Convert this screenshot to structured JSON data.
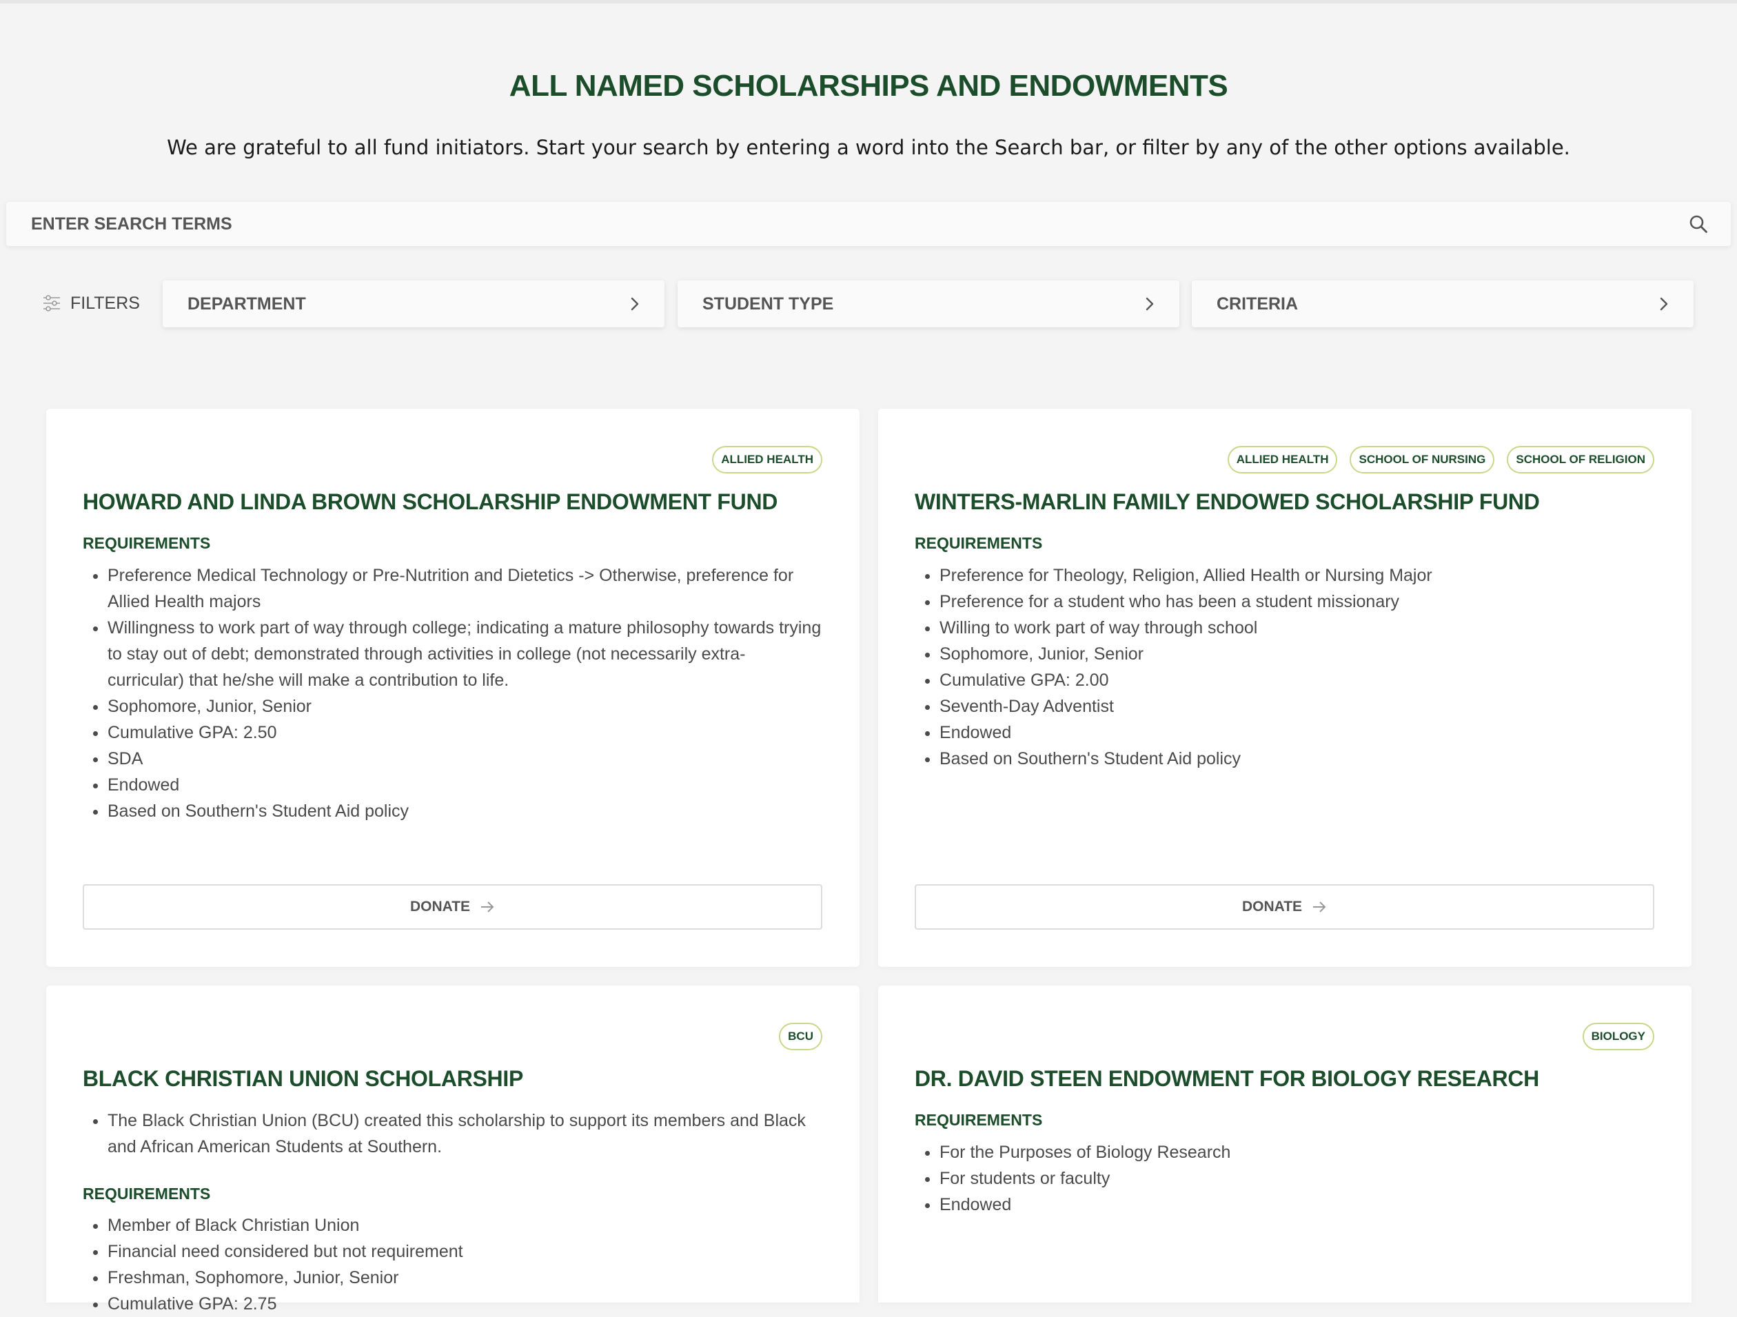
{
  "header": {
    "title": "ALL NAMED SCHOLARSHIPS AND ENDOWMENTS",
    "intro": "We are grateful to all fund initiators. Start your search by entering a word into the Search bar, or filter by any of the other options available."
  },
  "search": {
    "placeholder": "ENTER SEARCH TERMS",
    "value": ""
  },
  "filters": {
    "label": "FILTERS",
    "dropdowns": [
      {
        "label": "DEPARTMENT"
      },
      {
        "label": "STUDENT TYPE"
      },
      {
        "label": "CRITERIA"
      }
    ]
  },
  "cards": [
    {
      "tags": [
        "ALLIED HEALTH"
      ],
      "title": "HOWARD AND LINDA BROWN SCHOLARSHIP ENDOWMENT FUND",
      "requirements_label": "REQUIREMENTS",
      "requirements": [
        "Preference Medical Technology or Pre-Nutrition and Dietetics -> Otherwise, preference for Allied Health majors",
        "Willingness to work part of way through college; indicating a mature philosophy towards trying to stay out of debt; demonstrated through activities in college (not necessarily extra-curricular) that he/she will make a contribution to life.",
        "Sophomore, Junior, Senior",
        "Cumulative GPA: 2.50",
        "SDA",
        "Endowed",
        "Based on Southern's Student Aid policy"
      ],
      "donate_label": "DONATE"
    },
    {
      "tags": [
        "ALLIED HEALTH",
        "SCHOOL OF NURSING",
        "SCHOOL OF RELIGION"
      ],
      "title": "WINTERS-MARLIN FAMILY ENDOWED SCHOLARSHIP FUND",
      "requirements_label": "REQUIREMENTS",
      "requirements": [
        "Preference for Theology, Religion, Allied Health or Nursing Major",
        "Preference for a student who has been a student missionary",
        "Willing to work part of way through school",
        "Sophomore, Junior, Senior",
        "Cumulative GPA: 2.00",
        "Seventh-Day Adventist",
        "Endowed",
        "Based on Southern's Student Aid policy"
      ],
      "donate_label": "DONATE"
    },
    {
      "tags": [
        "BCU"
      ],
      "title": "BLACK CHRISTIAN UNION SCHOLARSHIP",
      "description": [
        "The Black Christian Union (BCU) created this scholarship to support its members and Black and African American Students at Southern."
      ],
      "requirements_label": "REQUIREMENTS",
      "requirements": [
        "Member of Black Christian Union",
        "Financial need considered but not requirement",
        "Freshman, Sophomore, Junior, Senior",
        "Cumulative GPA: 2.75"
      ]
    },
    {
      "tags": [
        "BIOLOGY"
      ],
      "title": "DR. DAVID STEEN ENDOWMENT FOR BIOLOGY RESEARCH",
      "requirements_label": "REQUIREMENTS",
      "requirements": [
        "For the Purposes of Biology Research",
        "For students or faculty",
        "Endowed"
      ]
    }
  ],
  "colors": {
    "brand_green": "#1c4d2b",
    "tag_border": "#c8d88a",
    "background": "#f4f4f4"
  },
  "icons": {
    "search": "search-icon",
    "filters": "sliders-icon",
    "dropdown": "chevron-right-icon",
    "donate": "arrow-right-icon"
  }
}
